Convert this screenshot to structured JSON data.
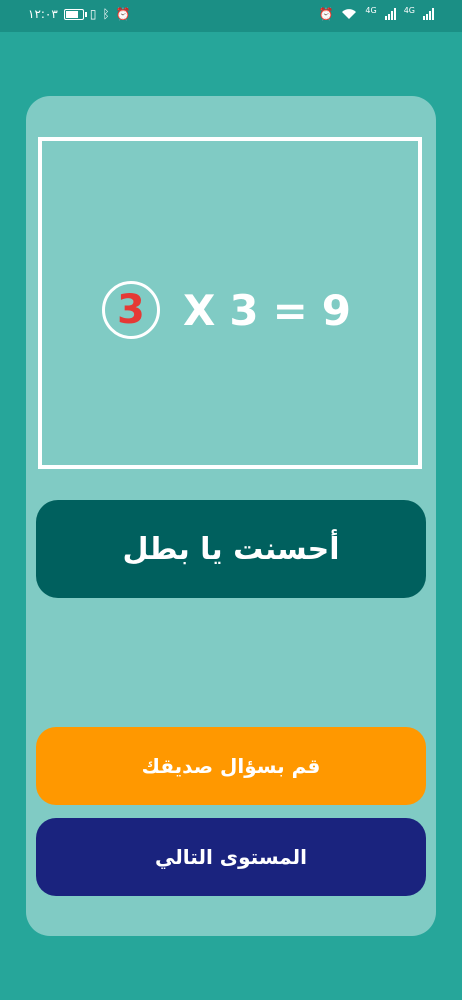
{
  "status_bar": {
    "time": "١٢:٠٣",
    "network_left": "4G",
    "network_right": "4G",
    "icons": [
      "battery-icon",
      "vibrate-icon",
      "bluetooth-icon",
      "alarm-icon",
      "wifi-icon",
      "signal-icon"
    ]
  },
  "question": {
    "answer": "3",
    "operator": "X",
    "operand": "3",
    "equals": "=",
    "result": "9"
  },
  "feedback": {
    "message": "أحسنت يا بطل"
  },
  "actions": {
    "ask_friend_label": "قم بسؤال صديقك",
    "next_level_label": "المستوى التالي"
  },
  "colors": {
    "background": "#26A69A",
    "card": "#80CBC4",
    "feedback_bg": "#00605E",
    "ask_friend_bg": "#FF9800",
    "next_level_bg": "#1A237E",
    "answer_color": "#E53935"
  }
}
